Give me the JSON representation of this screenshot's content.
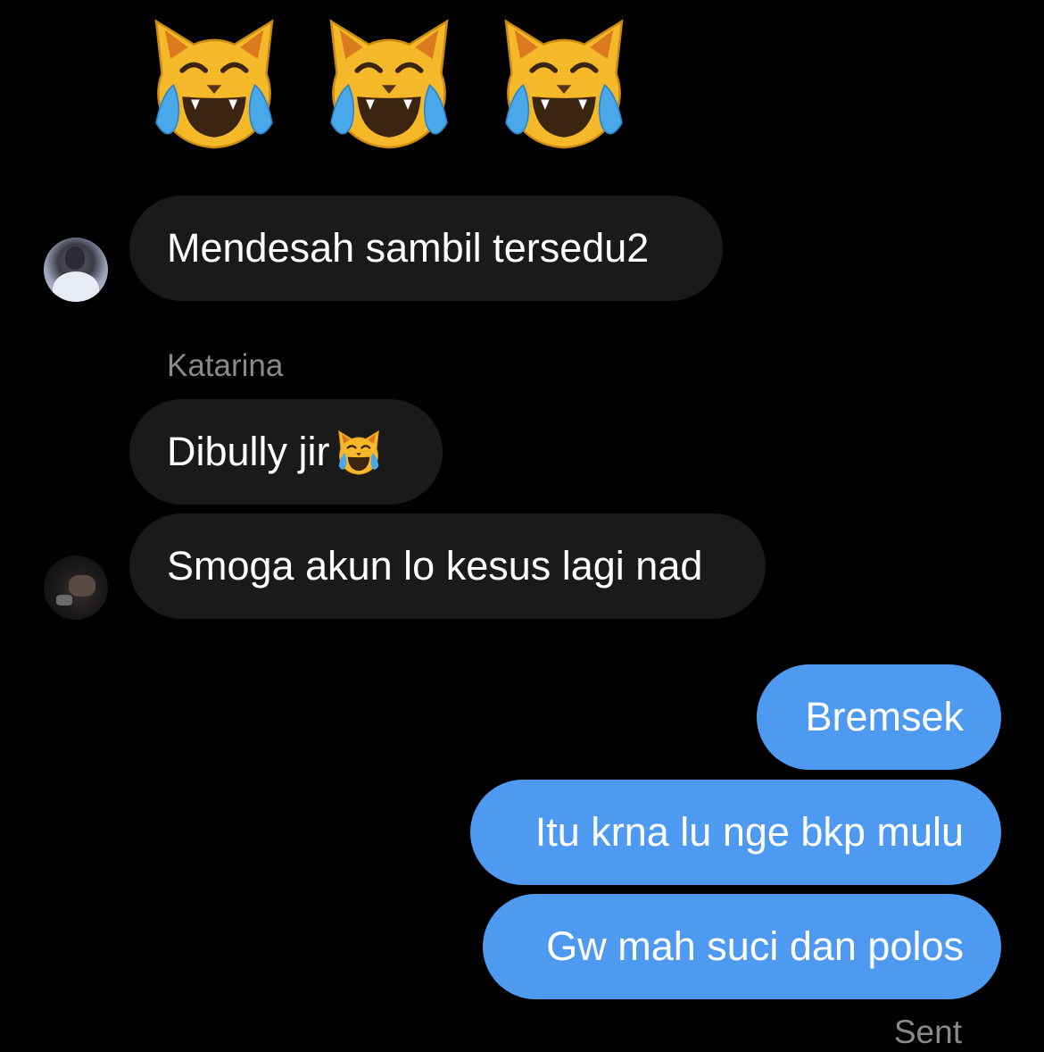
{
  "header_emoji": {
    "icons": [
      "cat-with-tears-of-joy-icon",
      "cat-with-tears-of-joy-icon",
      "cat-with-tears-of-joy-icon"
    ]
  },
  "messages": [
    {
      "text": "Mendesah sambil tersedu2",
      "direction": "incoming"
    },
    {
      "sender": "Katarina",
      "text": "Dibully jir",
      "emoji": "cat-with-tears-of-joy-icon",
      "direction": "incoming"
    },
    {
      "text": "Smoga akun lo kesus lagi nad",
      "direction": "incoming"
    },
    {
      "text": "Bremsek",
      "direction": "outgoing"
    },
    {
      "text": "Itu krna lu nge bkp mulu",
      "direction": "outgoing"
    },
    {
      "text": "Gw mah suci dan polos",
      "direction": "outgoing"
    }
  ],
  "status": "Sent",
  "colors": {
    "background": "#000000",
    "incoming_bubble": "#1a1a1a",
    "outgoing_bubble": "#4e9af1",
    "muted_text": "#8a8a8a"
  }
}
